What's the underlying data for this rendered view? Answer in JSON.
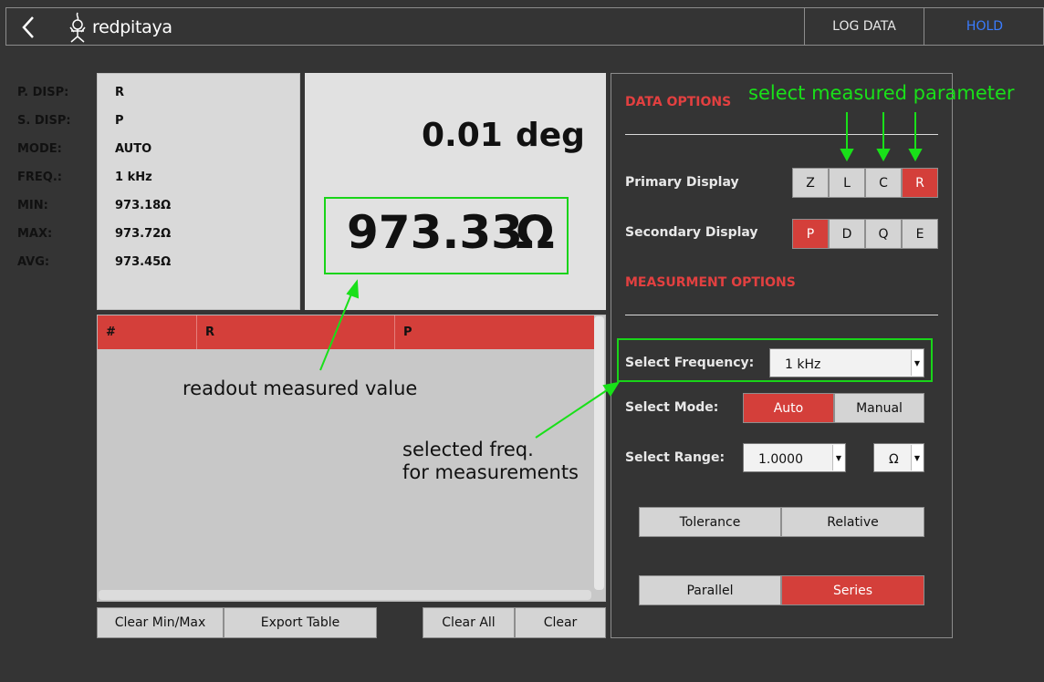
{
  "header": {
    "brand": "redpitaya",
    "log_data": "LOG DATA",
    "hold": "HOLD"
  },
  "info": [
    {
      "key": "P. DISP:",
      "value": "R"
    },
    {
      "key": "S. DISP:",
      "value": "P"
    },
    {
      "key": "MODE:",
      "value": "AUTO"
    },
    {
      "key": "FREQ.:",
      "value": "1 kHz"
    },
    {
      "key": "MIN:",
      "value": "973.18Ω"
    },
    {
      "key": "MAX:",
      "value": "973.72Ω"
    },
    {
      "key": "AVG:",
      "value": "973.45Ω"
    }
  ],
  "display": {
    "secondary_value": "0.01",
    "secondary_unit": "deg",
    "primary_value": "973.33",
    "primary_unit": "Ω"
  },
  "table": {
    "columns": [
      "#",
      "R",
      "P"
    ]
  },
  "bottom_buttons": {
    "clear_minmax": "Clear Min/Max",
    "export_table": "Export Table",
    "clear_all": "Clear All",
    "clear": "Clear"
  },
  "panel": {
    "data_options_title": "DATA OPTIONS",
    "primary_display_label": "Primary Display",
    "primary_options": [
      "Z",
      "L",
      "C",
      "R"
    ],
    "primary_selected": "R",
    "secondary_display_label": "Secondary Display",
    "secondary_options": [
      "P",
      "D",
      "Q",
      "E"
    ],
    "secondary_selected": "P",
    "measurement_options_title": "MEASURMENT OPTIONS",
    "frequency_label": "Select Frequency:",
    "frequency_value": "1 kHz",
    "mode_label": "Select Mode:",
    "mode_auto": "Auto",
    "mode_manual": "Manual",
    "range_label": "Select Range:",
    "range_value": "1.0000",
    "range_unit": "Ω",
    "tolerance": "Tolerance",
    "relative": "Relative",
    "parallel": "Parallel",
    "series": "Series"
  },
  "annotations": {
    "select_param": "select measured parameter",
    "readout": "readout measured value",
    "freq_line1": "selected freq.",
    "freq_line2": "for measurements"
  },
  "colors": {
    "accent_red": "#d43f3a",
    "annotation_green": "#19e019",
    "hold_blue": "#3a7cff",
    "background": "#343434"
  }
}
